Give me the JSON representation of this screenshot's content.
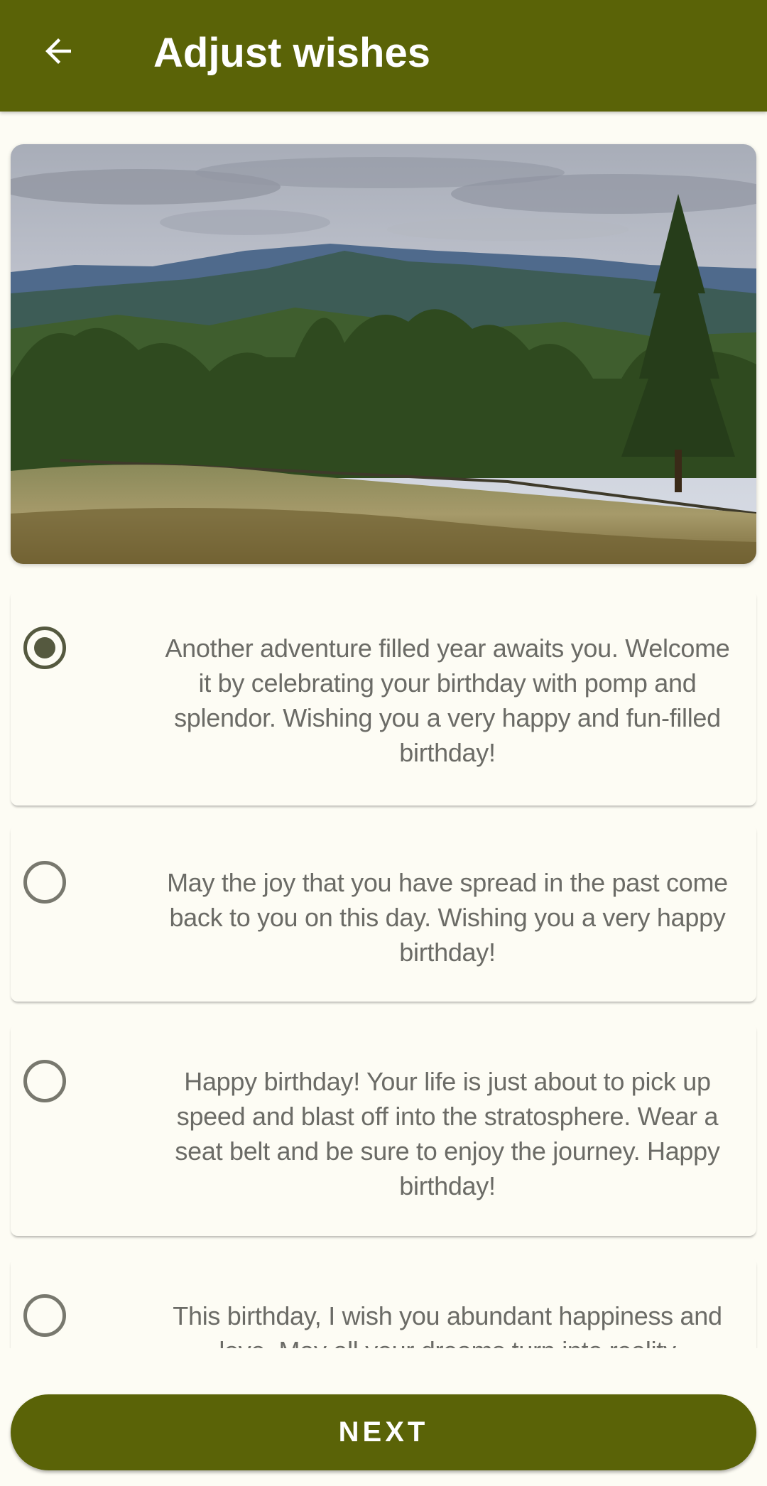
{
  "app_bar": {
    "title": "Adjust wishes",
    "back_icon": "arrow-back-icon",
    "color": "#5a6307"
  },
  "hero_image": {
    "subject": "mountain-landscape-photo"
  },
  "wishes": [
    {
      "text": "Another adventure filled year awaits you. Welcome it by celebrating your birthday with pomp and splendor. Wishing you a very happy and fun-filled birthday!",
      "selected": true
    },
    {
      "text": "May the joy that you have spread in the past come back to you on this day. Wishing you a very happy birthday!",
      "selected": false
    },
    {
      "text": "Happy birthday! Your life is just about to pick up speed and blast off into the stratosphere. Wear a seat belt and be sure to enjoy the journey. Happy birthday!",
      "selected": false
    },
    {
      "text": "This birthday, I wish you abundant happiness and love. May all your dreams turn into reality",
      "selected": false
    }
  ],
  "next_button": {
    "label": "NEXT"
  }
}
